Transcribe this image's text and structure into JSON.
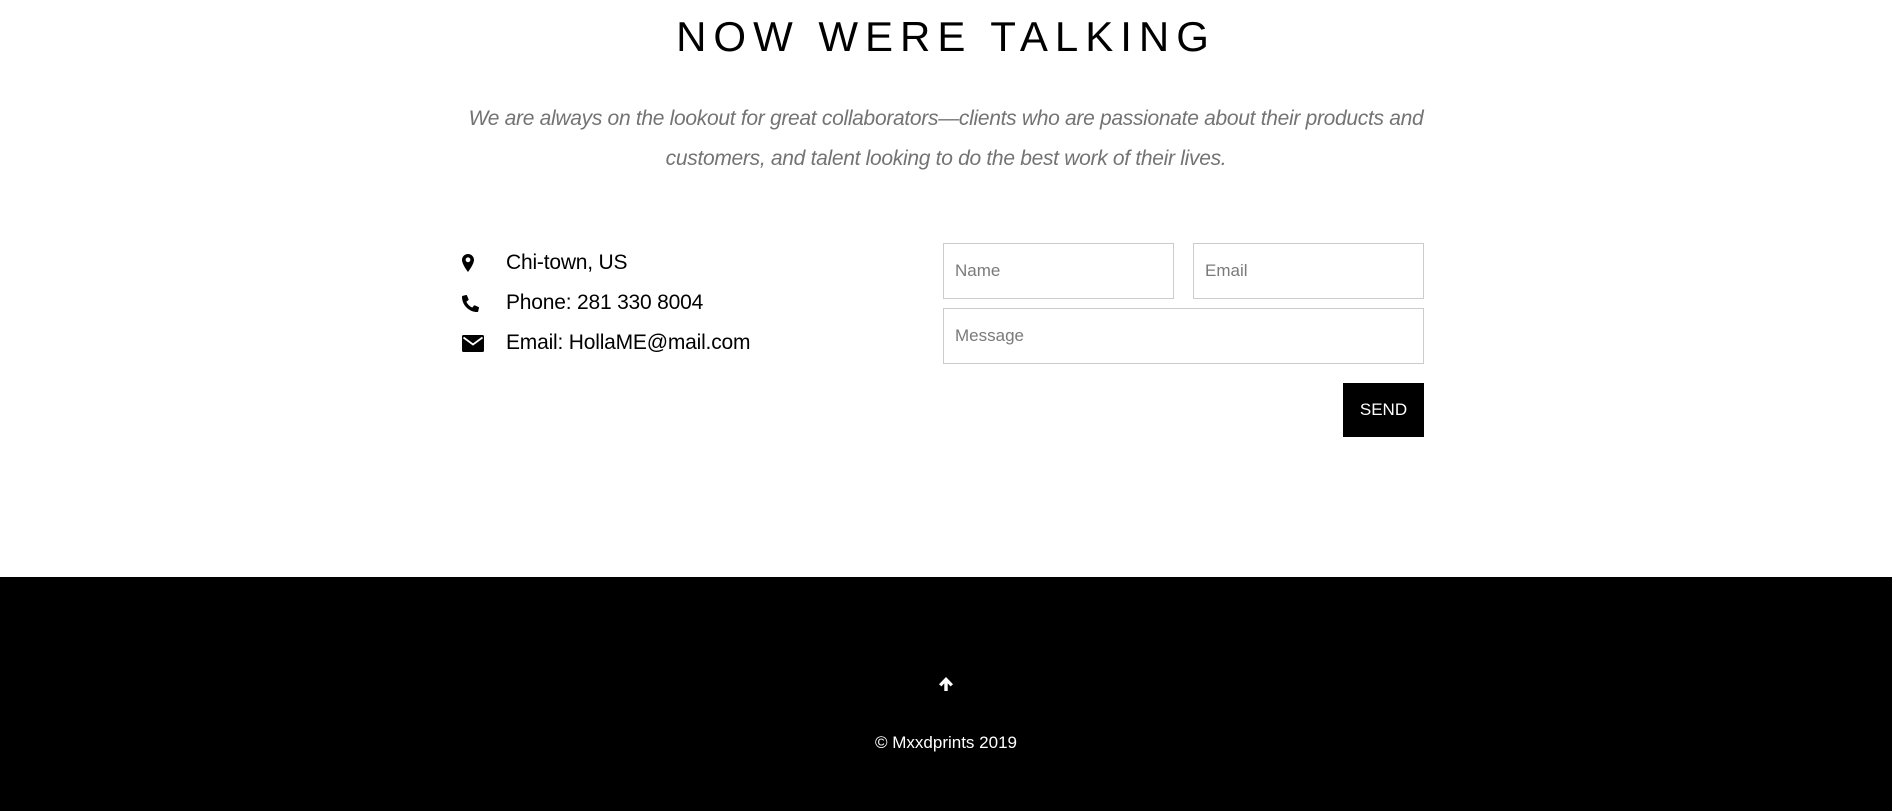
{
  "contact": {
    "title": "NOW WERE TALKING",
    "intro_line1": "We are always on the lookout for great collaborators—clients who are passionate about their products and",
    "intro_line2": "customers, and talent looking to do the best work of their lives.",
    "info": [
      {
        "icon": "map-marker-icon",
        "text": "Chi-town, US"
      },
      {
        "icon": "phone-icon",
        "text": "Phone: 281 330 8004"
      },
      {
        "icon": "envelope-icon",
        "text": "Email: HollaME@mail.com"
      }
    ],
    "form": {
      "name_placeholder": "Name",
      "email_placeholder": "Email",
      "message_placeholder": "Message",
      "send_label": "SEND"
    }
  },
  "footer": {
    "back_to_top_icon": "arrow-up-icon",
    "copyright": "© Mxxdprints 2019"
  },
  "colors": {
    "background": "#ffffff",
    "footer_background": "#000000",
    "intro_text": "#737373",
    "field_border": "#cccccc",
    "button_background": "#000000",
    "button_text": "#ffffff"
  }
}
